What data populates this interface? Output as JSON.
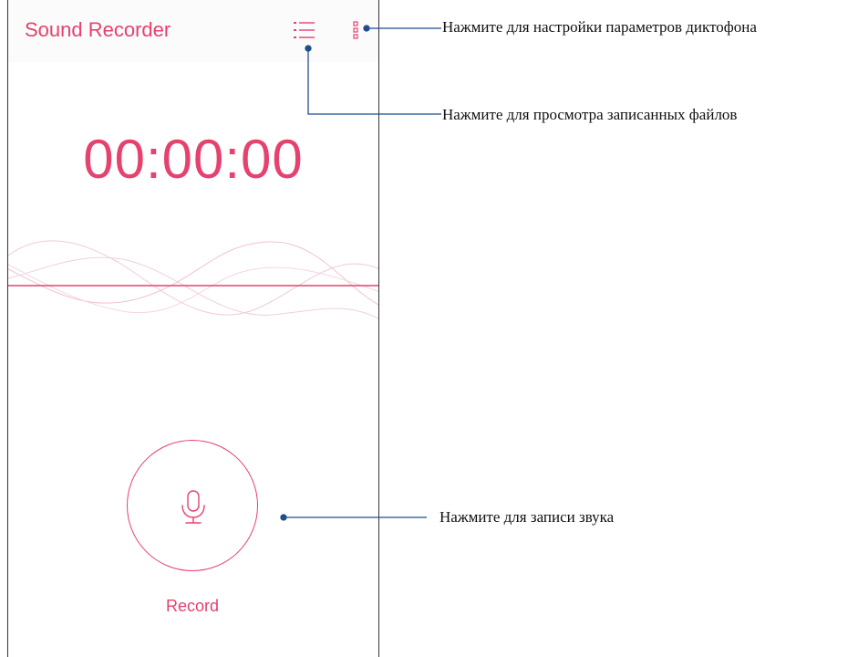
{
  "app": {
    "title": "Sound Recorder",
    "accent_color": "#e5426e"
  },
  "toolbar": {
    "list_icon": "list-icon",
    "menu_icon": "more-vertical-icon"
  },
  "timer": {
    "value": "00:00:00"
  },
  "record": {
    "icon": "microphone-icon",
    "label": "Record"
  },
  "callouts": {
    "settings": "Нажмите для настройки параметров диктофона",
    "files": "Нажмите для просмотра записанных файлов",
    "record": "Нажмите для записи звука",
    "line_color": "#1f4e8c"
  }
}
